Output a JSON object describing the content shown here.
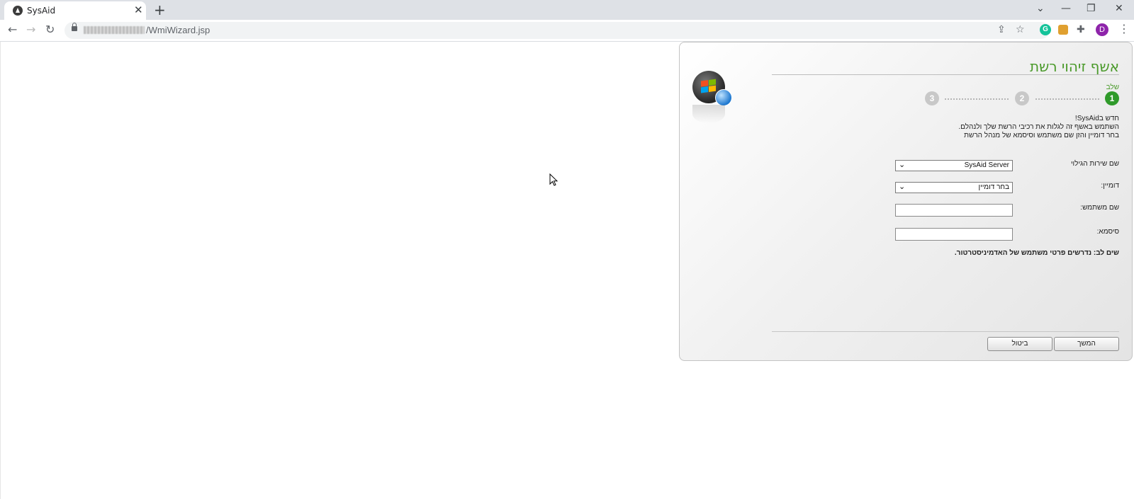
{
  "browser": {
    "tab_title": "SysAid",
    "tab_close": "✕",
    "new_tab": "+",
    "url_path": "/WmiWizard.jsp",
    "profile_initial": "D",
    "grammarly_letter": "G",
    "icons": {
      "back": "arrow-left-icon",
      "forward": "arrow-right-icon",
      "reload": "reload-icon",
      "share": "share-icon",
      "bookmark": "star-icon",
      "extensions": "puzzle-icon",
      "menu": "kebab-menu-icon"
    }
  },
  "wizard": {
    "title": "אשף זיהוי רשת",
    "step_label": "שלב",
    "steps": [
      "1",
      "2",
      "3"
    ],
    "active_step": 1,
    "intro_lines": [
      "חדש בSysAid!",
      "השתמש באשף זה לגלות את רכיבי הרשת שלך ולנהלם.",
      "בחר דומיין והזן שם משתמש וסיסמא של מנהל הרשת"
    ],
    "fields": {
      "discovery_service_label": "שם שירות הגילוי",
      "discovery_service_value": "SysAid Server",
      "domain_label": "דומיין:",
      "domain_value": "בחר דומיין",
      "username_label": "שם משתמש:",
      "username_value": "",
      "password_label": "סיסמא:",
      "password_value": ""
    },
    "note": "שים לב: נדרשים פרטי משתמש של האדמיניסטרטור.",
    "buttons": {
      "next": "המשך",
      "cancel": "ביטול"
    },
    "colors": {
      "title": "#4a9a2a",
      "active_step": "#2f9a2a",
      "inactive_step": "#c8c8c8"
    }
  }
}
